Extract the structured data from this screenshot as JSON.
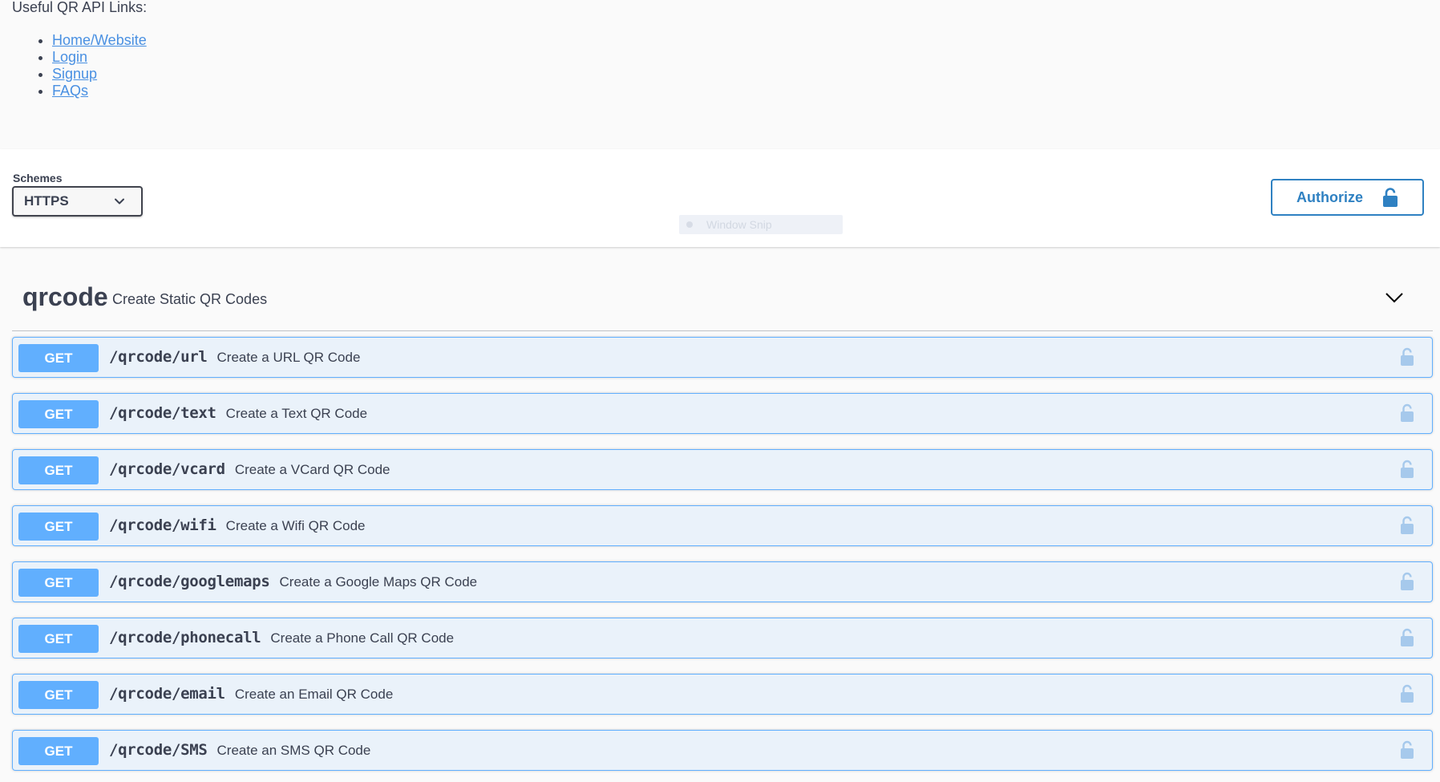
{
  "info": {
    "heading": "Useful QR API Links:",
    "links": [
      {
        "label": "Home/Website"
      },
      {
        "label": "Login"
      },
      {
        "label": "Signup"
      },
      {
        "label": "FAQs"
      }
    ]
  },
  "schemes": {
    "label": "Schemes",
    "selected": "HTTPS"
  },
  "overlay": {
    "window_snip": "Window Snip"
  },
  "authorize": {
    "label": "Authorize",
    "icon": "unlocked-lock-icon"
  },
  "tag": {
    "name": "qrcode",
    "description": "Create Static QR Codes",
    "expanded": true
  },
  "colors": {
    "get_method": "#61affe",
    "link": "#4990e2",
    "authorize": "#2f81c2",
    "text": "#3b4151"
  },
  "operations": [
    {
      "method": "GET",
      "path": "/qrcode/url",
      "summary": "Create a URL QR Code"
    },
    {
      "method": "GET",
      "path": "/qrcode/text",
      "summary": "Create a Text QR Code"
    },
    {
      "method": "GET",
      "path": "/qrcode/vcard",
      "summary": "Create a VCard QR Code"
    },
    {
      "method": "GET",
      "path": "/qrcode/wifi",
      "summary": "Create a Wifi QR Code"
    },
    {
      "method": "GET",
      "path": "/qrcode/googlemaps",
      "summary": "Create a Google Maps QR Code"
    },
    {
      "method": "GET",
      "path": "/qrcode/phonecall",
      "summary": "Create a Phone Call QR Code"
    },
    {
      "method": "GET",
      "path": "/qrcode/email",
      "summary": "Create an Email QR Code"
    },
    {
      "method": "GET",
      "path": "/qrcode/SMS",
      "summary": "Create an SMS QR Code"
    }
  ]
}
